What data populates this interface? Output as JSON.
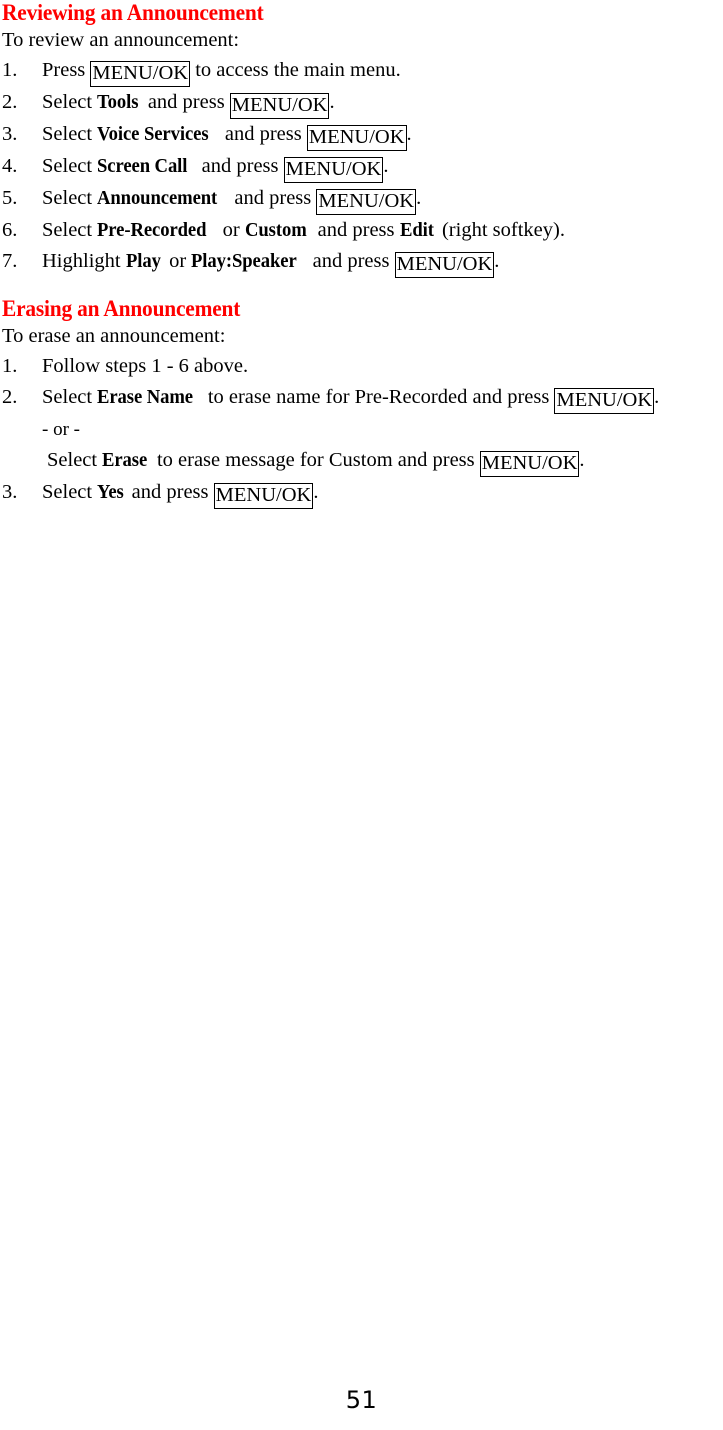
{
  "document": {
    "page_number": "51",
    "heading_color": "#FF0000",
    "text_color": "#000000",
    "background_color": "#FFFFFF"
  },
  "sections": [
    {
      "heading": "Reviewing an Announcement",
      "lead": "To review an announcement:",
      "steps": [
        {
          "number": "1.",
          "parts": [
            {
              "type": "text",
              "value": "Press "
            },
            {
              "type": "key",
              "value": "MENU/OK"
            },
            {
              "type": "text",
              "value": " to access the main menu."
            }
          ]
        },
        {
          "number": "2.",
          "parts": [
            {
              "type": "text",
              "value": "Select "
            },
            {
              "type": "bold",
              "value": "Tools"
            },
            {
              "type": "text",
              "value": " and press "
            },
            {
              "type": "key",
              "value": "MENU/OK"
            },
            {
              "type": "text",
              "value": "."
            }
          ]
        },
        {
          "number": "3.",
          "parts": [
            {
              "type": "text",
              "value": "Select "
            },
            {
              "type": "bold",
              "value": "Voice Services"
            },
            {
              "type": "text",
              "value": " and press "
            },
            {
              "type": "key",
              "value": "MENU/OK"
            },
            {
              "type": "text",
              "value": "."
            }
          ]
        },
        {
          "number": "4.",
          "parts": [
            {
              "type": "text",
              "value": "Select "
            },
            {
              "type": "bold",
              "value": "Screen Call"
            },
            {
              "type": "text",
              "value": " and press "
            },
            {
              "type": "key",
              "value": "MENU/OK"
            },
            {
              "type": "text",
              "value": "."
            }
          ]
        },
        {
          "number": "5.",
          "parts": [
            {
              "type": "text",
              "value": "Select "
            },
            {
              "type": "bold",
              "value": "Announcement"
            },
            {
              "type": "text",
              "value": " and press "
            },
            {
              "type": "key",
              "value": "MENU/OK"
            },
            {
              "type": "text",
              "value": "."
            }
          ]
        },
        {
          "number": "6.",
          "parts": [
            {
              "type": "text",
              "value": "Select "
            },
            {
              "type": "bold",
              "value": "Pre-Recorded"
            },
            {
              "type": "text",
              "value": " or "
            },
            {
              "type": "bold",
              "value": "Custom"
            },
            {
              "type": "text",
              "value": " and press "
            },
            {
              "type": "bold",
              "value": "Edit"
            },
            {
              "type": "text",
              "value": " (right softkey)."
            }
          ]
        },
        {
          "number": "7.",
          "parts": [
            {
              "type": "text",
              "value": "Highlight "
            },
            {
              "type": "bold",
              "value": "Play"
            },
            {
              "type": "text",
              "value": " or "
            },
            {
              "type": "bold",
              "value": "Play:Speaker"
            },
            {
              "type": "text",
              "value": " and press "
            },
            {
              "type": "key",
              "value": "MENU/OK"
            },
            {
              "type": "text",
              "value": "."
            }
          ]
        }
      ]
    },
    {
      "heading": "Erasing an Announcement",
      "lead": "To erase an announcement:",
      "steps": [
        {
          "number": "1.",
          "parts": [
            {
              "type": "text",
              "value": "Follow steps 1 - 6 above."
            }
          ]
        },
        {
          "number": "2.",
          "parts": [
            {
              "type": "text",
              "value": "Select "
            },
            {
              "type": "bold",
              "value": "Erase Name"
            },
            {
              "type": "text",
              "value": " to erase name for Pre-Recorded and press "
            },
            {
              "type": "key",
              "value": "MENU/OK"
            },
            {
              "type": "text",
              "value": "."
            }
          ],
          "sublines": [
            {
              "style": "small-or",
              "parts": [
                {
                  "type": "text",
                  "value": "- or -"
                }
              ]
            },
            {
              "style": "indent-extra",
              "parts": [
                {
                  "type": "text",
                  "value": "Select "
                },
                {
                  "type": "bold",
                  "value": "Erase"
                },
                {
                  "type": "text",
                  "value": " to erase message for Custom and press "
                },
                {
                  "type": "key",
                  "value": "MENU/OK"
                },
                {
                  "type": "text",
                  "value": "."
                }
              ]
            }
          ]
        },
        {
          "number": "3.",
          "parts": [
            {
              "type": "text",
              "value": "Select "
            },
            {
              "type": "bold",
              "value": "Yes"
            },
            {
              "type": "text",
              "value": " and press "
            },
            {
              "type": "key",
              "value": "MENU/OK"
            },
            {
              "type": "text",
              "value": "."
            }
          ]
        }
      ]
    }
  ]
}
